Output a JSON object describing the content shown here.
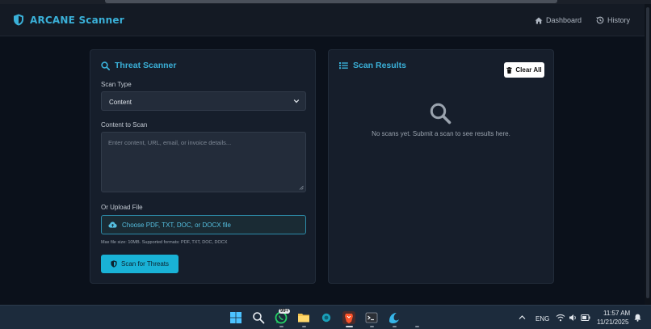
{
  "app": {
    "title": "ARCANE Scanner"
  },
  "nav": {
    "dashboard": "Dashboard",
    "history": "History"
  },
  "scanner": {
    "title": "Threat Scanner",
    "scan_type_label": "Scan Type",
    "scan_type_value": "Content",
    "content_label": "Content to Scan",
    "content_placeholder": "Enter content, URL, email, or invoice details...",
    "upload_label": "Or Upload File",
    "upload_button": "Choose PDF, TXT, DOC, or DOCX file",
    "upload_hint": "Max file size: 10MB. Supported formats: PDF, TXT, DOC, DOCX",
    "scan_button": "Scan for Threats"
  },
  "results": {
    "title": "Scan Results",
    "clear_button": "Clear All",
    "empty_message": "No scans yet. Submit a scan to see results here."
  },
  "taskbar": {
    "whatsapp_badge": "99+",
    "language": "ENG",
    "time": "11:57 AM",
    "date": "11/21/2025"
  },
  "colors": {
    "accent": "#3ab0d8",
    "button": "#19b2d6",
    "background": "#0b111b",
    "card": "#161e2b"
  }
}
